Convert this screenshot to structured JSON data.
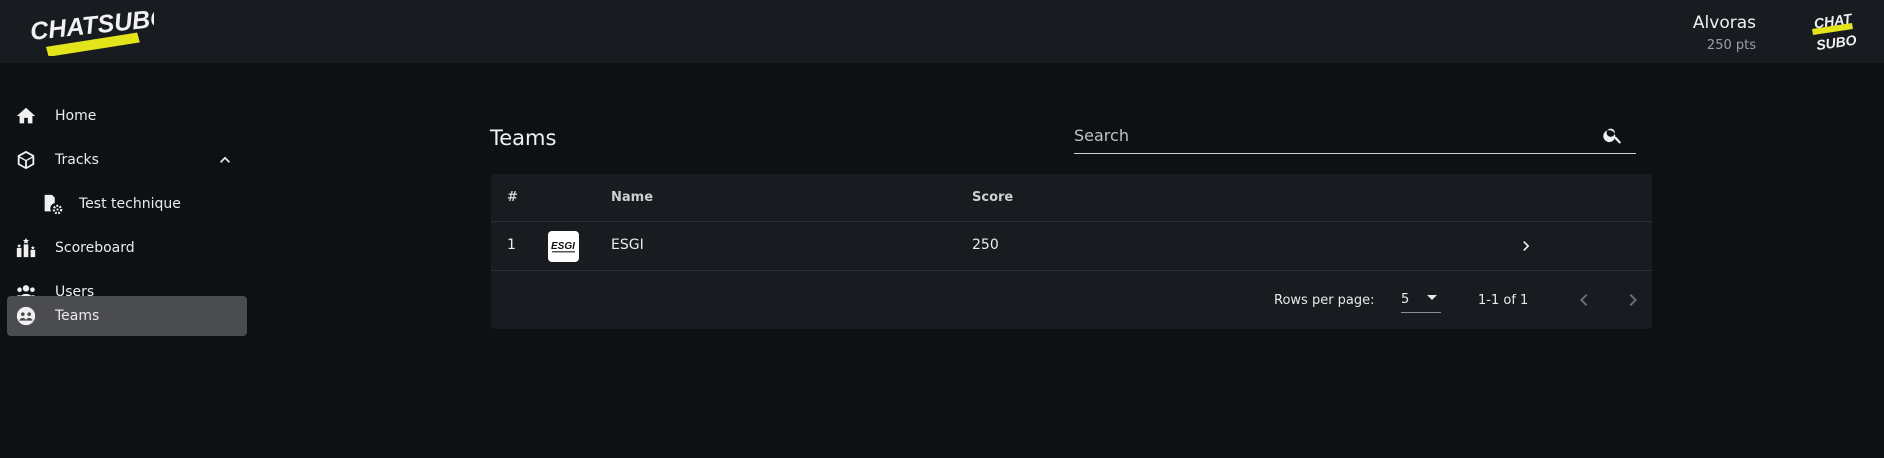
{
  "header": {
    "brand": "CHATSUBO",
    "user_name": "Alvoras",
    "user_points": "250 pts",
    "avatar_text_top": "CHAT",
    "avatar_text_bottom": "SUBO"
  },
  "sidebar": {
    "items": [
      {
        "label": "Home",
        "icon": "home-icon"
      },
      {
        "label": "Tracks",
        "icon": "cube-icon",
        "expanded": true
      },
      {
        "label": "Test technique",
        "icon": "challenge-settings-icon"
      },
      {
        "label": "Scoreboard",
        "icon": "scoreboard-icon"
      },
      {
        "label": "Users",
        "icon": "users-icon"
      },
      {
        "label": "Teams",
        "icon": "teams-icon",
        "active": true
      }
    ]
  },
  "main": {
    "title": "Teams",
    "search_placeholder": "Search"
  },
  "table": {
    "headers": [
      "#",
      "",
      "Name",
      "Score"
    ],
    "rows": [
      {
        "rank": "1",
        "logo_text": "ESGI",
        "name": "ESGI",
        "score": "250"
      }
    ],
    "rows_per_page_label": "Rows per page:",
    "rows_per_page": "5",
    "range": "1-1 of 1"
  },
  "colors": {
    "background": "#0e1114",
    "header_bg": "#181b20",
    "active_nav": "#4a4c4f",
    "brand_yellow": "#e3e51a"
  }
}
